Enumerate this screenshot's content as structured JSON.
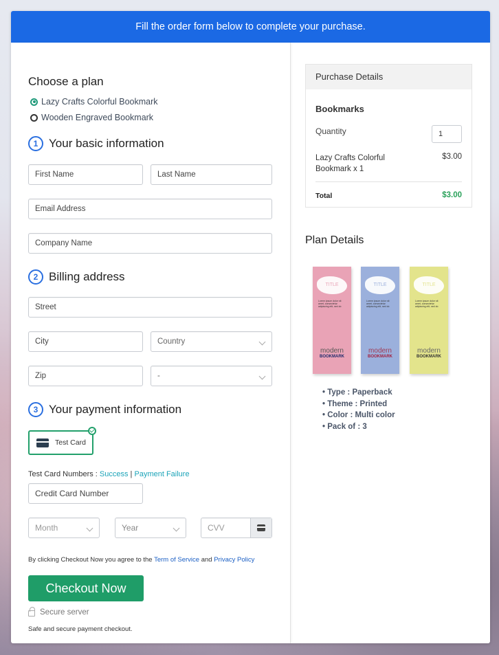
{
  "banner": {
    "text": "Fill the order form below to complete your purchase."
  },
  "form": {
    "plan_heading": "Choose a plan",
    "plans": [
      {
        "label": "Lazy Crafts Colorful Bookmark",
        "selected": true
      },
      {
        "label": "Wooden Engraved Bookmark",
        "selected": false
      }
    ],
    "sections": [
      {
        "number": "1",
        "title": "Your basic information"
      },
      {
        "number": "2",
        "title": "Billing address"
      },
      {
        "number": "3",
        "title": "Your payment information"
      }
    ],
    "fields": {
      "first_name": {
        "placeholder": "First Name",
        "value": ""
      },
      "last_name": {
        "placeholder": "Last Name",
        "value": ""
      },
      "email": {
        "placeholder": "Email Address",
        "value": ""
      },
      "company": {
        "placeholder": "Company Name",
        "value": ""
      },
      "street": {
        "placeholder": "Street",
        "value": ""
      },
      "city": {
        "placeholder": "City",
        "value": ""
      },
      "country": {
        "selected": "Country"
      },
      "zip": {
        "placeholder": "Zip",
        "value": ""
      },
      "state": {
        "selected": "-"
      },
      "card_number": {
        "placeholder": "Credit Card Number",
        "value": ""
      },
      "month": {
        "selected": "Month"
      },
      "year": {
        "selected": "Year"
      },
      "cvv": {
        "placeholder": "CVV",
        "value": ""
      }
    },
    "payment_method": {
      "label": "Test Card",
      "selected": true
    },
    "test_card": {
      "prefix": "Test Card Numbers : ",
      "success": "Success",
      "separator": " | ",
      "failure": "Payment Failure"
    },
    "terms": {
      "prefix": "By clicking Checkout Now you agree to the ",
      "tos": "Term of Service",
      "and": " and ",
      "privacy": "Privacy Policy"
    },
    "checkout_label": "Checkout Now",
    "secure_label": "Secure server",
    "safe_label": "Safe and secure payment checkout."
  },
  "purchase": {
    "heading": "Purchase Details",
    "product": "Bookmarks",
    "quantity_label": "Quantity",
    "quantity": "1",
    "item_label": "Lazy Crafts Colorful Bookmark x 1",
    "item_price": "$3.00",
    "total_label": "Total",
    "total_value": "$3.00"
  },
  "plan": {
    "heading": "Plan Details",
    "bookmarks": [
      {
        "title": "TITLE",
        "modern": "modern",
        "brand": "BOOKMARK",
        "color": "#e9a3b6",
        "modern_color": "#555",
        "brand_color": "#1f2a6b"
      },
      {
        "title": "TITLE",
        "modern": "modern",
        "brand": "BOOKMARK",
        "color": "#9bb0dc",
        "modern_color": "#a03a55",
        "brand_color": "#a3203f"
      },
      {
        "title": "TITLE",
        "modern": "modern",
        "brand": "BOOKMARK",
        "color": "#e3e48c",
        "modern_color": "#666",
        "brand_color": "#333"
      }
    ],
    "lorem": "Lorem ipsum dolor sit amet, consectetur adipiscing elit, sed do",
    "specs": [
      "Type : Paperback",
      "Theme : Printed",
      "Color : Multi color",
      "Pack of : 3"
    ]
  },
  "colors": {
    "brand_blue": "#1b69e4",
    "checkout_green": "#1f9d68",
    "total_green": "#2aa15a",
    "link_teal": "#1aa3b8"
  }
}
